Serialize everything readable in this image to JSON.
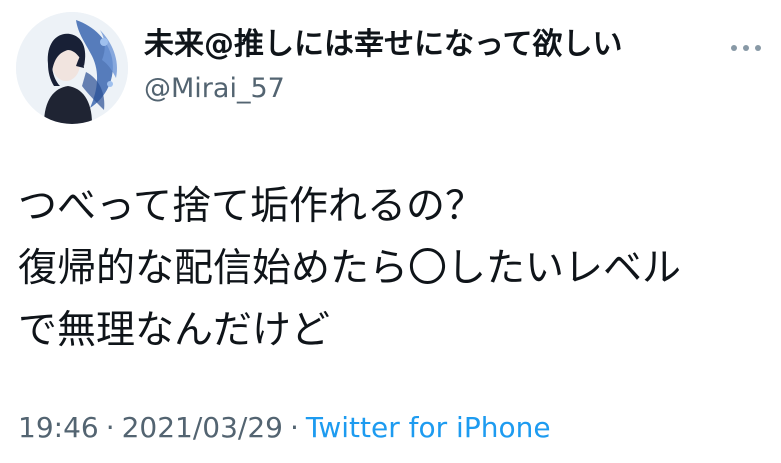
{
  "author": {
    "display_name": "未来@推しには幸せになって欲しい",
    "handle": "@Mirai_57",
    "avatar_icon": "profile-avatar-icon"
  },
  "menu": {
    "icon": "more-options-icon"
  },
  "tweet": {
    "lines": [
      "つべって捨て垢作れるの？",
      "復帰的な配信始めたら〇したいレベル",
      "で無理なんだけど"
    ]
  },
  "meta": {
    "time": "19:46",
    "separator": "·",
    "date": "2021/03/29",
    "source": "Twitter for iPhone"
  },
  "colors": {
    "text": "#0f1419",
    "secondary": "#536471",
    "link": "#1d9bf0"
  }
}
